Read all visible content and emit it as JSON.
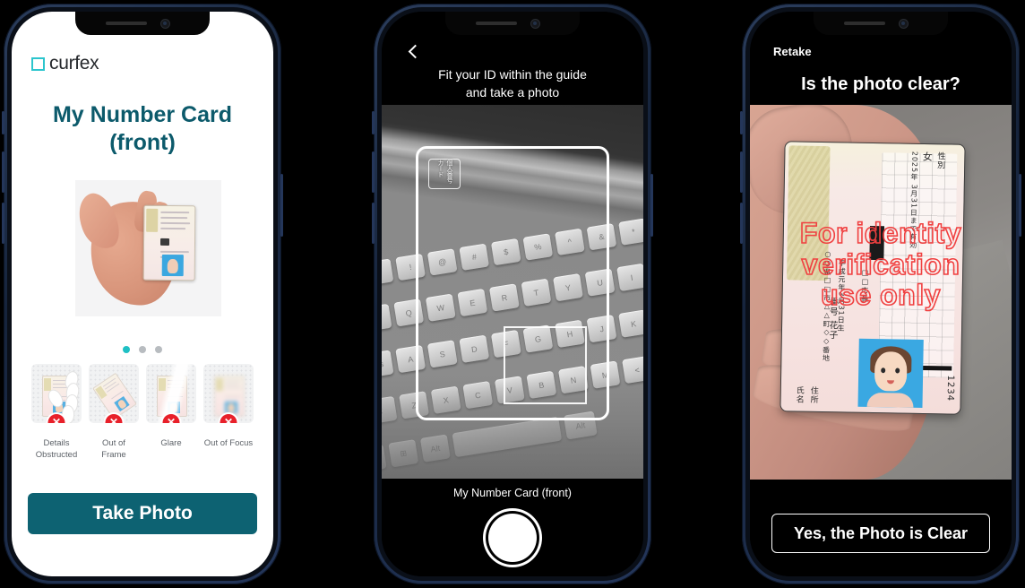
{
  "phone1": {
    "logo": "curfex",
    "title": "My Number Card\n(front)",
    "title_line1": "My Number Card",
    "title_line2": "(front)",
    "hero_alt": "hand holding my number card",
    "carousel": {
      "total": 3,
      "active_index": 0
    },
    "examples": [
      {
        "label_line1": "Details",
        "label_line2": "Obstructed",
        "badge": "✕"
      },
      {
        "label_line1": "Out of",
        "label_line2": "Frame",
        "badge": "✕"
      },
      {
        "label_line1": "Glare",
        "label_line2": "",
        "badge": "✕"
      },
      {
        "label_line1": "Out of Focus",
        "label_line2": "",
        "badge": "✕"
      }
    ],
    "primary_button": "Take Photo",
    "colors": {
      "accent_teal": "#0d6272",
      "title_teal": "#0c5a6b",
      "dot_active": "#1fc0c4",
      "badge_red": "#e8202a",
      "logo_mark": "#2cc5cd"
    }
  },
  "phone2": {
    "back_icon": "chevron-left-icon",
    "hint_line1": "Fit your ID within the guide",
    "hint_line2": "and take a photo",
    "guide_chip_text": "個人番号カード",
    "caption": "My Number Card (front)",
    "shutter_label": "shutter-button",
    "colors": {
      "guide_border": "#ffffff",
      "background": "#000000"
    }
  },
  "phone3": {
    "retake": "Retake",
    "title": "Is the photo clear?",
    "watermark_line1": "For identity",
    "watermark_line2": "verification",
    "watermark_line3": "use only",
    "card_fields": {
      "name_label": "氏名",
      "name_value": "番号 花子",
      "address_label": "住所",
      "address_value": "○○県□□市△△町◇◇番地",
      "birth_value": "平成元年3月31日生",
      "sex_label": "性別",
      "sex_value": "女",
      "expiry_value": "2025年 3月31日まで有効",
      "issuer": "□□市長",
      "number": "1234"
    },
    "primary_button": "Yes, the Photo is Clear",
    "colors": {
      "watermark_red": "#f04040",
      "button_border": "#ffffff",
      "background": "#000000"
    }
  }
}
